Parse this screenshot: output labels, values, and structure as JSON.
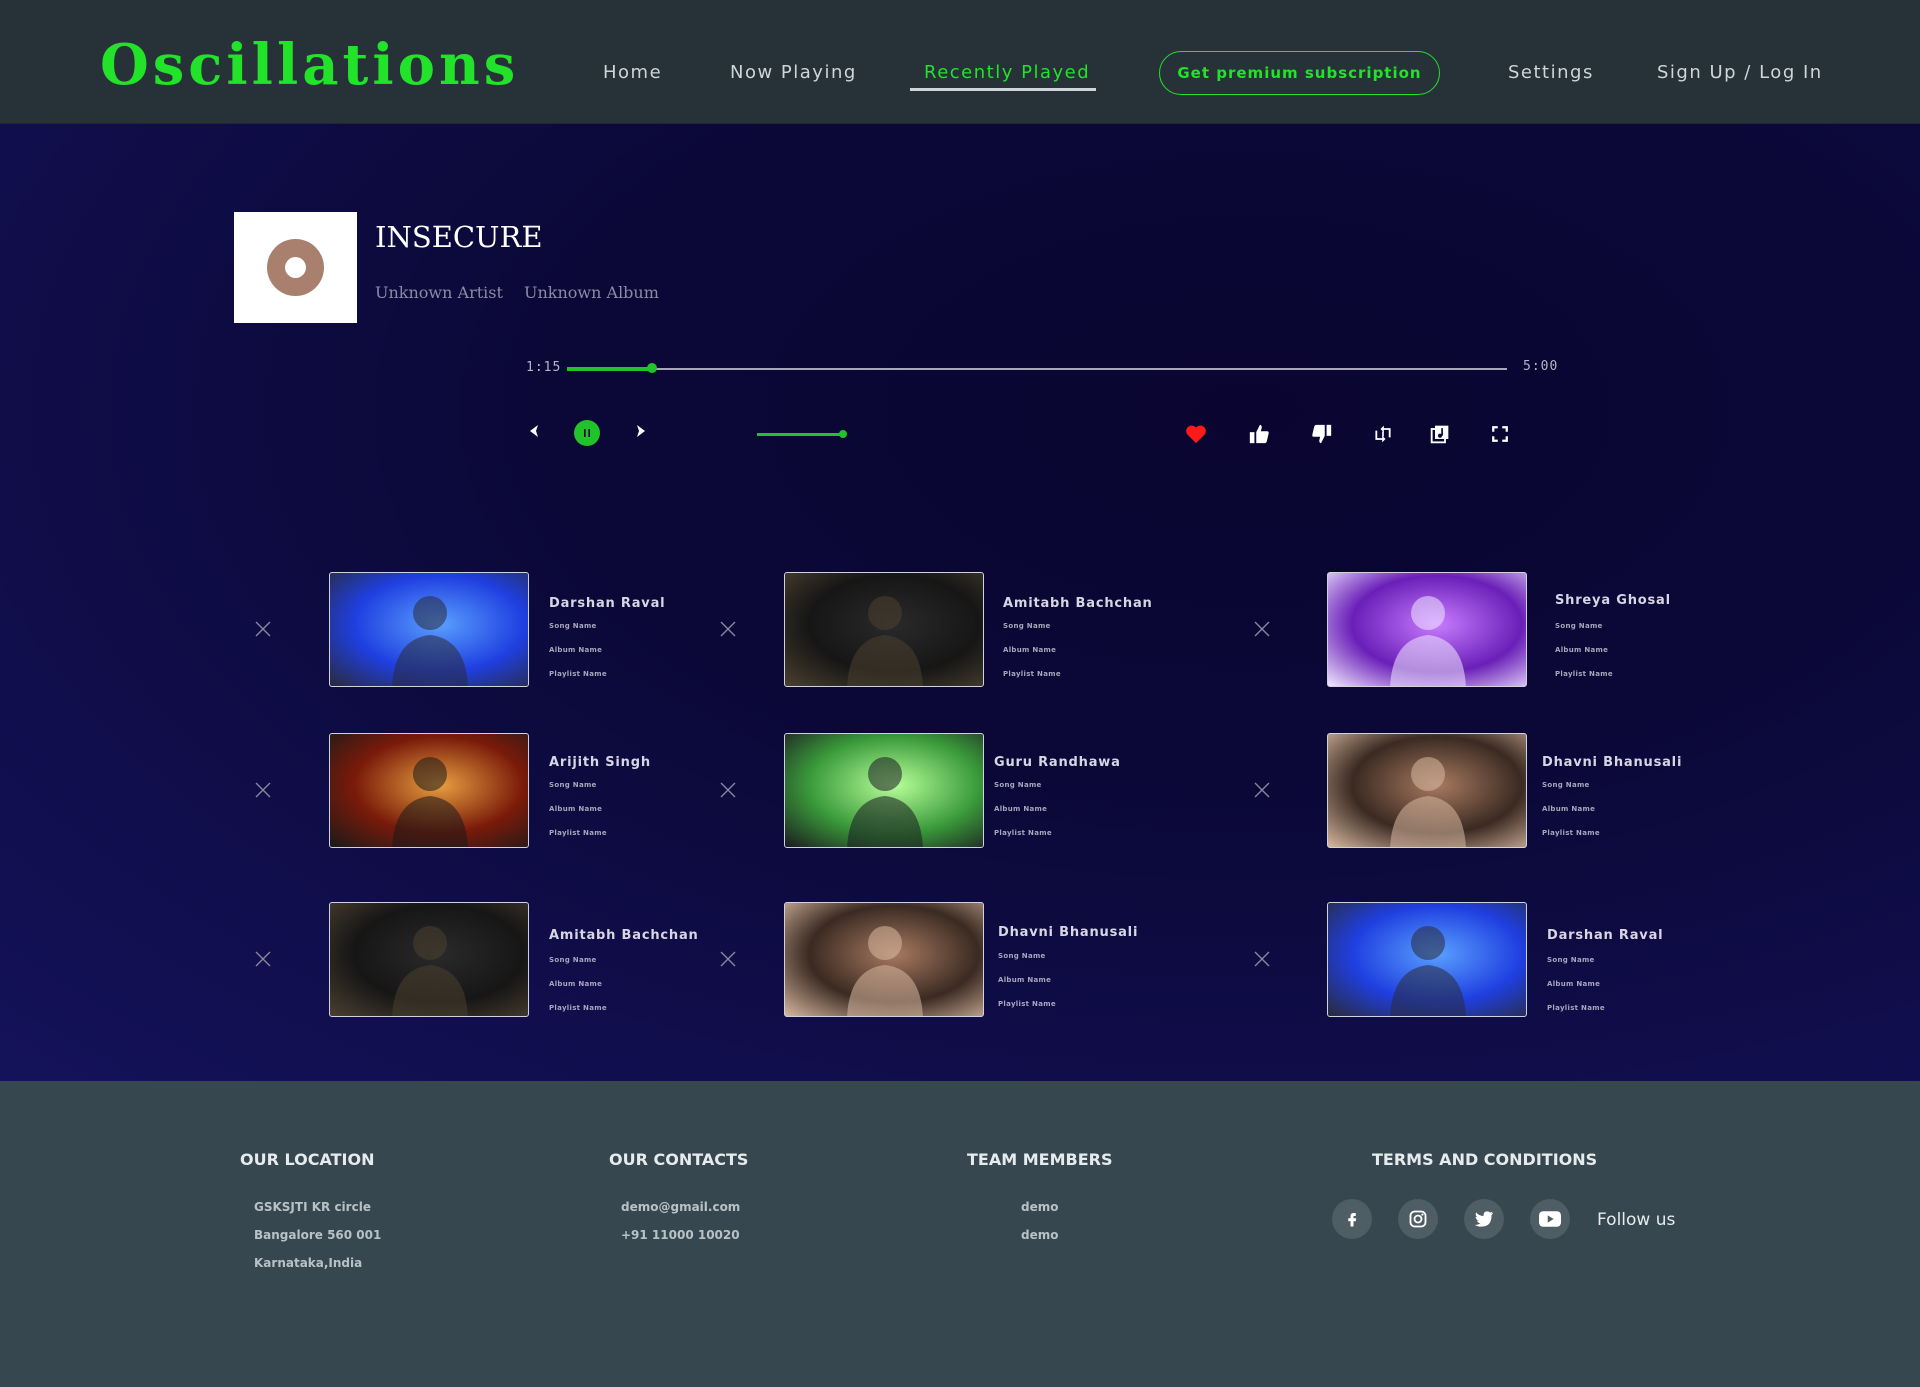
{
  "header": {
    "logo": "Oscillations",
    "nav": {
      "home": "Home",
      "now_playing": "Now Playing",
      "recently_played": "Recently Played",
      "premium": "Get premium subscription",
      "settings": "Settings",
      "signup": "Sign Up / Log In"
    },
    "active": "Recently Played"
  },
  "player": {
    "title": "INSECURE",
    "artist": "Unknown Artist",
    "album": "Unknown Album",
    "current_time": "1:15",
    "total_time": "5:00",
    "progress_fraction": 0.09,
    "volume_fraction": 1.0,
    "liked": true
  },
  "recent": [
    {
      "artist": "Darshan Raval",
      "song": "Song Name",
      "album": "Album Name",
      "playlist": "Playlist Name"
    },
    {
      "artist": "Amitabh Bachchan",
      "song": "Song Name",
      "album": "Album Name",
      "playlist": "Playlist Name"
    },
    {
      "artist": "Shreya Ghosal",
      "song": "Song Name",
      "album": "Album Name",
      "playlist": "Playlist Name"
    },
    {
      "artist": "Arijith Singh",
      "song": "Song Name",
      "album": "Album Name",
      "playlist": "Playlist Name"
    },
    {
      "artist": "Guru Randhawa",
      "song": "Song Name",
      "album": "Album Name",
      "playlist": "Playlist Name"
    },
    {
      "artist": "Dhavni Bhanusali",
      "song": "Song Name",
      "album": "Album Name",
      "playlist": "Playlist Name"
    },
    {
      "artist": "Amitabh Bachchan",
      "song": "Song Name",
      "album": "Album Name",
      "playlist": "Playlist Name"
    },
    {
      "artist": "Dhavni Bhanusali",
      "song": "Song Name",
      "album": "Album Name",
      "playlist": "Playlist Name"
    },
    {
      "artist": "Darshan Raval",
      "song": "Song Name",
      "album": "Album Name",
      "playlist": "Playlist Name"
    }
  ],
  "footer": {
    "location": {
      "heading": "OUR LOCATION",
      "lines": [
        "GSKSJTI KR circle",
        "Bangalore 560 001",
        "Karnataka,India"
      ]
    },
    "contacts": {
      "heading": "OUR CONTACTS",
      "lines": [
        "demo@gmail.com",
        "+91 11000 10020"
      ]
    },
    "team": {
      "heading": "TEAM MEMBERS",
      "lines": [
        "demo",
        "demo"
      ]
    },
    "terms": {
      "heading": "TERMS AND CONDITIONS"
    },
    "follow": "Follow us",
    "social_icons": [
      "facebook-icon",
      "instagram-icon",
      "twitter-icon",
      "youtube-icon"
    ]
  },
  "colors": {
    "accent": "#22e22a",
    "header_bg": "#263238",
    "main_bg": "#0b0838",
    "footer_bg": "#37474f",
    "heart": "#ff1a1a"
  }
}
